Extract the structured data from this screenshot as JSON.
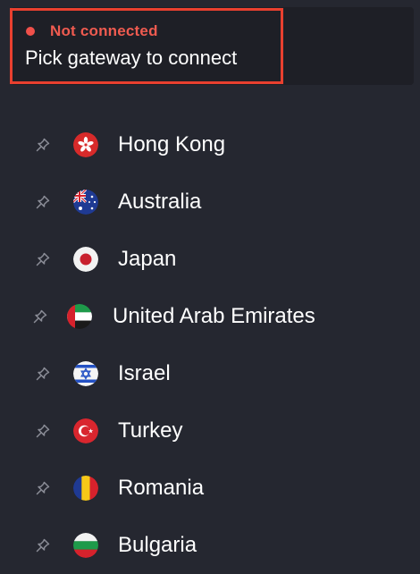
{
  "status": {
    "state": "Not connected",
    "prompt": "Pick gateway to connect",
    "dot_color": "#f0504a",
    "highlight_color": "#e9402f"
  },
  "gateways": [
    {
      "name": "Hong Kong",
      "flag": "hong-kong-flag-icon",
      "pin": "pin-icon"
    },
    {
      "name": "Australia",
      "flag": "australia-flag-icon",
      "pin": "pin-icon"
    },
    {
      "name": "Japan",
      "flag": "japan-flag-icon",
      "pin": "pin-icon"
    },
    {
      "name": "United Arab Emirates",
      "flag": "uae-flag-icon",
      "pin": "pin-icon"
    },
    {
      "name": "Israel",
      "flag": "israel-flag-icon",
      "pin": "pin-icon"
    },
    {
      "name": "Turkey",
      "flag": "turkey-flag-icon",
      "pin": "pin-icon"
    },
    {
      "name": "Romania",
      "flag": "romania-flag-icon",
      "pin": "pin-icon"
    },
    {
      "name": "Bulgaria",
      "flag": "bulgaria-flag-icon",
      "pin": "pin-icon"
    }
  ]
}
